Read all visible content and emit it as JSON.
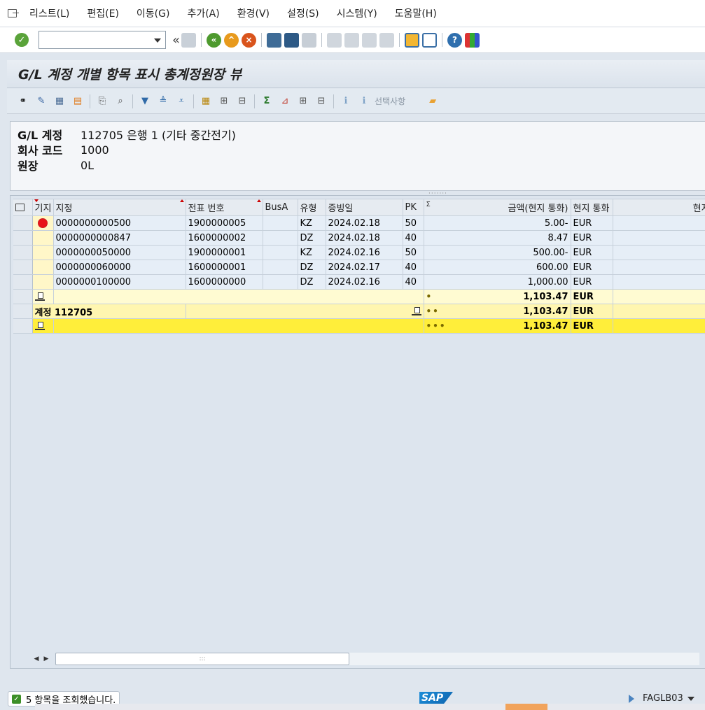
{
  "menu": {
    "items": [
      "리스트(L)",
      "편집(E)",
      "이동(G)",
      "추가(A)",
      "환경(V)",
      "설정(S)",
      "시스템(Y)",
      "도움말(H)"
    ]
  },
  "toolbar": {
    "command_value": "",
    "icons": [
      "enter-icon",
      "back-icon",
      "exit-icon",
      "cancel-icon",
      "print-icon",
      "find-icon",
      "find-next-icon",
      "first-page-icon",
      "prev-page-icon",
      "next-page-icon",
      "last-page-icon",
      "new-session-icon",
      "shortcut-icon",
      "help-icon",
      "customize-layout-icon"
    ]
  },
  "title": "G/L 계정 개별 항목 표시 총계정원장 뷰",
  "app_toolbar": {
    "selection_label": "선택사항"
  },
  "header": {
    "rows": [
      {
        "label": "G/L 계정",
        "value": "112705 은행 1 (기타 중간전기)"
      },
      {
        "label": "회사 코드",
        "value": "1000"
      },
      {
        "label": "원장",
        "value": "0L"
      }
    ]
  },
  "grid": {
    "columns": [
      "기지",
      "지정",
      "전표 번호",
      "BusA",
      "유형",
      "증빙일",
      "PK",
      "금액(현지 통화)",
      "현지 통화",
      "현지통"
    ],
    "rows": [
      {
        "assignment": "0000000000500",
        "doc_no": "1900000005",
        "busa": "",
        "type": "KZ",
        "date": "2024.02.18",
        "pk": "50",
        "amount": "5.00-",
        "currency": "EUR"
      },
      {
        "assignment": "0000000000847",
        "doc_no": "1600000002",
        "busa": "",
        "type": "DZ",
        "date": "2024.02.18",
        "pk": "40",
        "amount": "8.47",
        "currency": "EUR"
      },
      {
        "assignment": "0000000050000",
        "doc_no": "1900000001",
        "busa": "",
        "type": "KZ",
        "date": "2024.02.16",
        "pk": "50",
        "amount": "500.00-",
        "currency": "EUR"
      },
      {
        "assignment": "0000000060000",
        "doc_no": "1600000001",
        "busa": "",
        "type": "DZ",
        "date": "2024.02.17",
        "pk": "40",
        "amount": "600.00",
        "currency": "EUR"
      },
      {
        "assignment": "0000000100000",
        "doc_no": "1600000000",
        "busa": "",
        "type": "DZ",
        "date": "2024.02.16",
        "pk": "40",
        "amount": "1,000.00",
        "currency": "EUR"
      }
    ],
    "subtotal_status": {
      "dots": "•",
      "amount": "1,103.47",
      "currency": "EUR"
    },
    "subtotal_account": {
      "label": "계정",
      "value": "112705",
      "dots": "••",
      "amount": "1,103.47",
      "currency": "EUR"
    },
    "grand_total": {
      "dots": "•••",
      "amount": "1,103.47",
      "currency": "EUR"
    }
  },
  "status": {
    "message": "5 항목을 조회했습니다.",
    "transaction": "FAGLB03"
  }
}
